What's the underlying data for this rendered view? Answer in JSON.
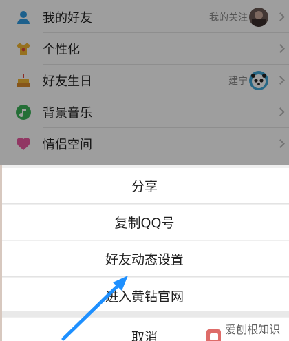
{
  "settings": {
    "items": [
      {
        "label": "我的好友",
        "sub": "我的关注",
        "icon": "person-icon",
        "has_avatar": true
      },
      {
        "label": "个性化",
        "sub": "",
        "icon": "tshirt-icon",
        "has_avatar": false
      },
      {
        "label": "好友生日",
        "sub": "建宁",
        "icon": "birthday-cake-icon",
        "has_avatar": true
      },
      {
        "label": "背景音乐",
        "sub": "",
        "icon": "music-note-icon",
        "has_avatar": false
      },
      {
        "label": "情侣空间",
        "sub": "",
        "icon": "heart-icon",
        "has_avatar": false
      }
    ]
  },
  "action_sheet": {
    "items": [
      "分享",
      "复制QQ号",
      "好友动态设置",
      "进入黄钻官网"
    ],
    "cancel": "取消"
  },
  "watermark": {
    "text": "爱刨根知识网"
  },
  "colors": {
    "arrow": "#1e90ff",
    "dim_overlay": "rgba(0,0,0,0.38)"
  }
}
